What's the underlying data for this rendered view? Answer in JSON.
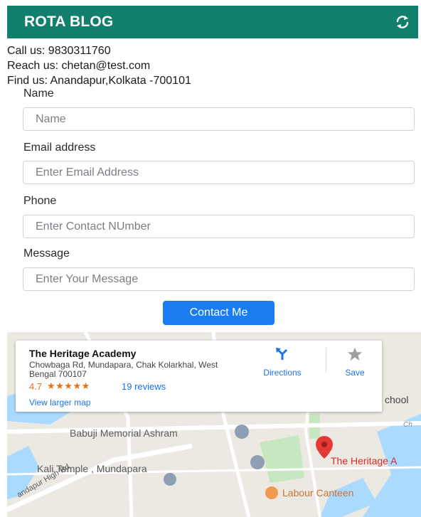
{
  "header": {
    "title": "ROTA BLOG",
    "icon": "refresh-icon",
    "color": "#127f6d"
  },
  "contact": {
    "call": "Call us: 9830311760",
    "reach": "Reach us: chetan@test.com",
    "find": "Find us: Anandapur,Kolkata -700101"
  },
  "form": {
    "name_label": "Name",
    "name_placeholder": "Name",
    "email_label": "Email address",
    "email_placeholder": "Enter Email Address",
    "phone_label": "Phone",
    "phone_placeholder": "Enter Contact NUmber",
    "message_label": "Message",
    "message_placeholder": "Enter Your Message",
    "submit_label": "Contact Me",
    "submit_color": "#1a7cf0"
  },
  "map": {
    "place_name": "The Heritage Academy",
    "address": "Chowbaga Rd, Mundapara, Chak Kolarkhal, West Bengal 700107",
    "rating": "4.7",
    "stars": "★★★★★",
    "reviews": "19 reviews",
    "view_larger": "View larger map",
    "directions": "Directions",
    "save": "Save",
    "labels": {
      "school": "chool",
      "ch": "Ch",
      "babuji": "Babuji Memorial Ashram",
      "kali": "Kali Temple , Mundapara",
      "heritage": "The Heritage A",
      "canteen": "Labour Canteen",
      "road": "andapur High Rd"
    }
  }
}
